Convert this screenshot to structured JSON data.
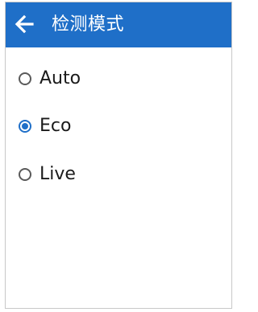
{
  "header": {
    "title": "检测模式",
    "back_icon": "arrow-left-icon",
    "background_color": "#1f6fc8"
  },
  "options": [
    {
      "label": "Auto",
      "checked": false
    },
    {
      "label": "Eco",
      "checked": true
    },
    {
      "label": "Live",
      "checked": false
    }
  ]
}
